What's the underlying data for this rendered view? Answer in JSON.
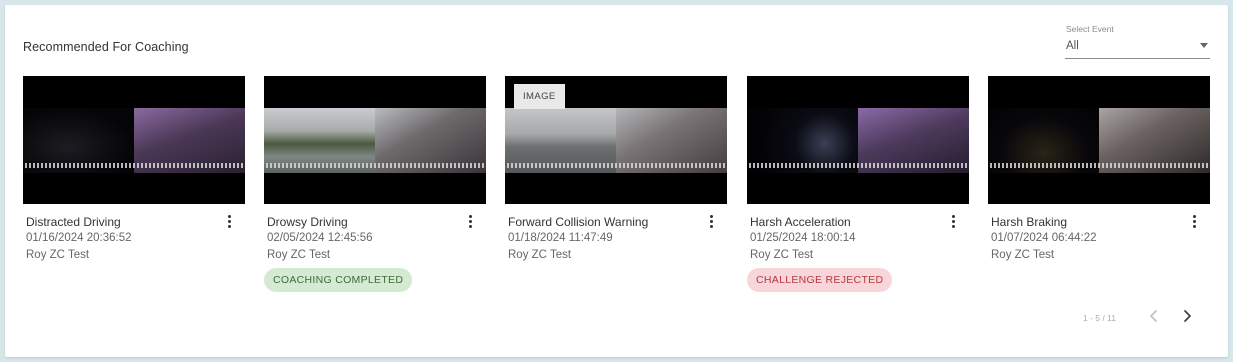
{
  "card": {
    "title": "Recommended For Coaching"
  },
  "filter": {
    "label": "Select Event",
    "value": "All"
  },
  "events": [
    {
      "name": "Distracted Driving",
      "date": "01/16/2024 20:36:52",
      "driver": "Roy ZC Test"
    },
    {
      "name": "Drowsy Driving",
      "date": "02/05/2024 12:45:56",
      "driver": "Roy ZC Test",
      "chip": "COACHING COMPLETED"
    },
    {
      "name": "Forward Collision Warning",
      "date": "01/18/2024 11:47:49",
      "driver": "Roy ZC Test",
      "badge": "IMAGE"
    },
    {
      "name": "Harsh Acceleration",
      "date": "01/25/2024 18:00:14",
      "driver": "Roy ZC Test",
      "chip": "CHALLENGE REJECTED"
    },
    {
      "name": "Harsh Braking",
      "date": "01/07/2024 06:44:22",
      "driver": "Roy ZC Test"
    }
  ],
  "pagination": {
    "range": "1 - 5 / 11"
  },
  "icons": {
    "menu": "more-vertical-icon",
    "prev": "chevron-left-icon",
    "next": "chevron-right-icon",
    "dropdown": "caret-down-icon"
  },
  "colors": {
    "completed_bg": "#d4ead2",
    "completed_text": "#3e6b3b",
    "rejected_bg": "#f6d6d8",
    "rejected_text": "#b8373f"
  }
}
